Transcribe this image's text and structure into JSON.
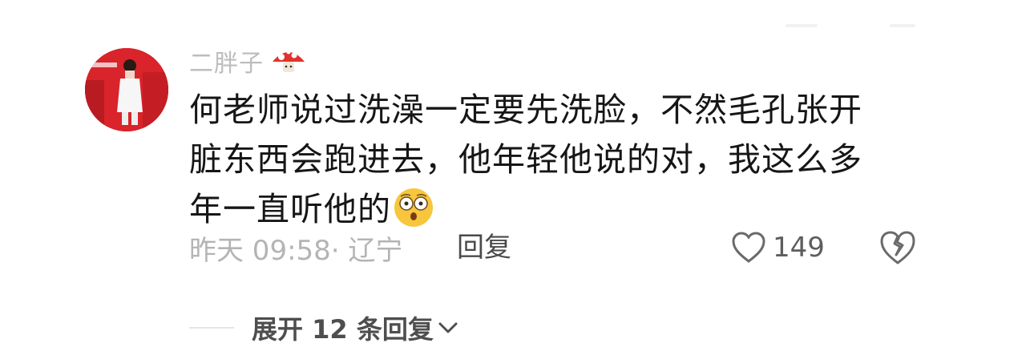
{
  "comment": {
    "username": "二胖子",
    "username_badge": "mushroom-badge-icon",
    "text_line1": "何老师说过洗澡一定要先洗脸，不然毛孔张开",
    "text_line2": "脏东西会跑进去，他年轻他说的对，我这么多",
    "text_line3": "年一直听他的",
    "emoji": "astonished-face-emoji",
    "time_location": "昨天 09:58· 辽宁",
    "reply_label": "回复",
    "like_count": "149",
    "like_icon": "heart-outline-icon",
    "dislike_icon": "broken-heart-icon"
  },
  "replies": {
    "expand_label": "展开 12 条回复",
    "expand_icon": "chevron-down-icon"
  },
  "colors": {
    "avatar_bg": "#d8242a",
    "text": "#161616",
    "muted": "#b4b4b4"
  }
}
